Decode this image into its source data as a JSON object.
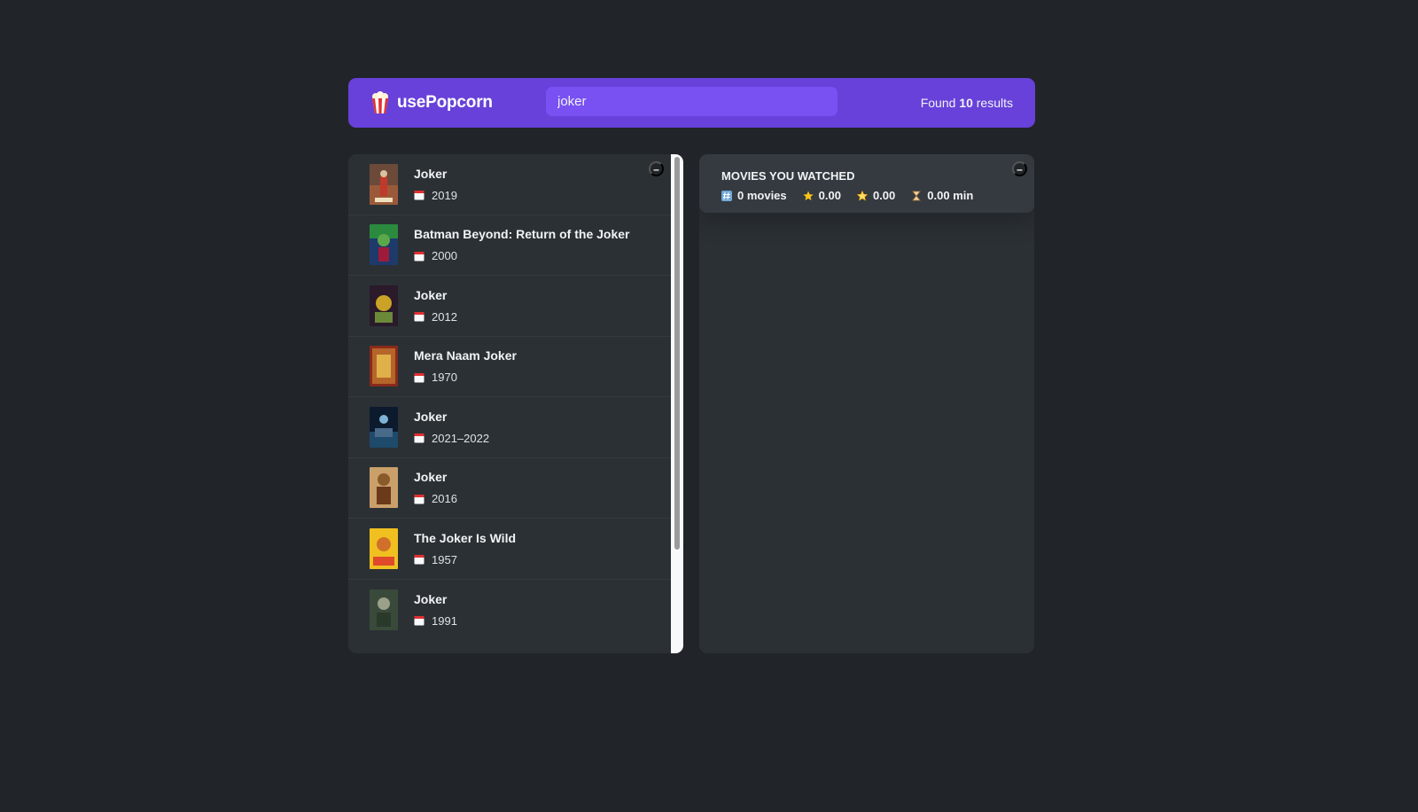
{
  "app": {
    "name": "usePopcorn",
    "logo_icon": "popcorn-icon"
  },
  "search": {
    "value": "joker",
    "placeholder": "Search movies..."
  },
  "results": {
    "prefix": "Found",
    "count": "10",
    "suffix": "results"
  },
  "movies": [
    {
      "title": "Joker",
      "year": "2019"
    },
    {
      "title": "Batman Beyond: Return of the Joker",
      "year": "2000"
    },
    {
      "title": "Joker",
      "year": "2012"
    },
    {
      "title": "Mera Naam Joker",
      "year": "1970"
    },
    {
      "title": "Joker",
      "year": "2021–2022"
    },
    {
      "title": "Joker",
      "year": "2016"
    },
    {
      "title": "The Joker Is Wild",
      "year": "1957"
    },
    {
      "title": "Joker",
      "year": "1991"
    }
  ],
  "toggle_label": "–",
  "summary": {
    "title": "Movies you watched",
    "movies": "0 movies",
    "imdb_rating": "0.00",
    "user_rating": "0.00",
    "runtime": "0.00 min"
  },
  "colors": {
    "background": "#212529",
    "nav": "#6741d9",
    "search": "#7950f2",
    "box": "#2b3035",
    "summary": "#343a40"
  }
}
